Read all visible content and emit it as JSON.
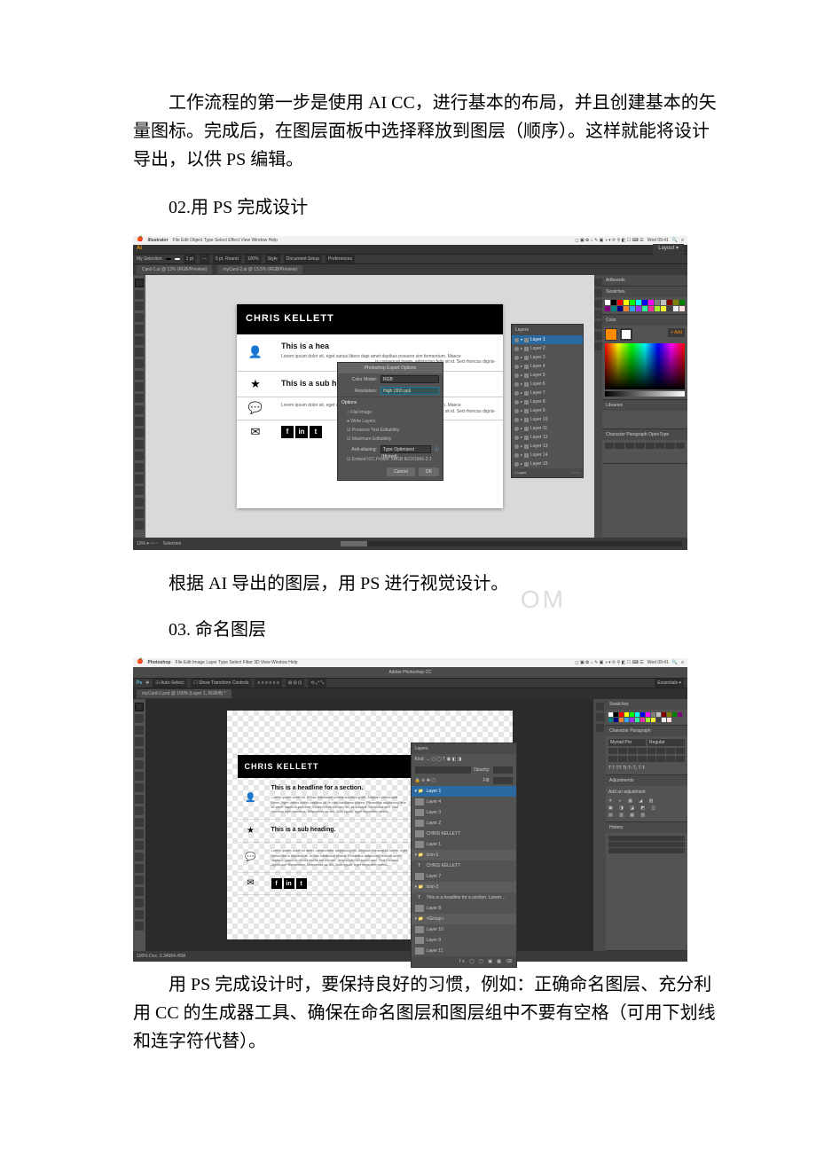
{
  "para1": "工作流程的第一步是使用 AI CC，进行基本的布局，并且创建基本的矢量图标。完成后，在图层面板中选择释放到图层（顺序）。这样就能将设计导出，以供 PS 编辑。",
  "h2": "02.用 PS 完成设计",
  "para2": "根据 AI 导出的图层，用 PS 进行视觉设计。",
  "h3": "03. 命名图层",
  "para3": "用 PS 完成设计时，要保持良好的习惯，例如：正确命名图层、充分利用 CC 的生成器工具、确保在命名图层和图层组中不要有空格（可用下划线和连字符代替）。",
  "watermark": "OM",
  "mac": {
    "ai_app": "Illustrator",
    "ps_app": "Photoshop",
    "menus_ai": "File  Edit  Object  Type  Select  Effect  View  Window  Help",
    "menus_ps": "File  Edit  Image  Layer  Type  Select  Filter  3D  View  Window  Help",
    "clock": "Wed 09:41",
    "status_icons": "◻ ▣ ✿ ⌂ ✎ ▣ ◑ ▾ ⟳ ⚲ ◧ ☐ ⌨ ☰"
  },
  "ai": {
    "brand": "Ai",
    "toolbar_right": "Layout ▾",
    "ctrlbar_left": "My Selection",
    "ctrlbar_doc": "Document Setup",
    "ctrlbar_pref": "Preferences",
    "tab1": "Card-1.ai @ 13% (RGB/Preview)",
    "tab2": "myCard-2.ai @ 13.5% (RGB/Preview)",
    "artboard_panel": "Artboards",
    "header": "CHRIS KELLETT",
    "row1_h": "This is a hea",
    "row1_p": "Lorem ipsum dolor sit, eget varius libero dapi amet dapibus posuere sim fermentum. Maece",
    "row1_p_tail": "is consequat lorem, adipiscing felis sit id. Sed rhoncus dignis-",
    "row2_h": "This is a sub he",
    "row2_p": "Lorem ipsum dolor sit, eget varius libero dapi amet dapibus posuere sim fermentum. Maece",
    "social": [
      "f",
      "in",
      "t"
    ],
    "dialog": {
      "title": "Photoshop Export Options",
      "color_model_lbl": "Color Model:",
      "color_model_val": "RGB",
      "resolution_lbl": "Resolution:",
      "resolution_val": "High (300 ppi)",
      "options": "Options",
      "opt1": "Flat Image",
      "opt2": "Write Layers",
      "opt3": "Preserve Text Editability",
      "opt4": "Maximum Editability",
      "aa_lbl": "Anti-aliasing:",
      "aa_val": "Type Optimized (Hinted)",
      "icc": "Embed ICC Profile: sRGB IEC61966-2.1",
      "cancel": "Cancel",
      "ok": "OK"
    },
    "layers": {
      "title": "Layers",
      "main": "Layer 1",
      "items": [
        "Layer 2",
        "Layer 3",
        "Layer 4",
        "Layer 5",
        "Layer 6",
        "Layer 7",
        "Layer 8",
        "Layer 9",
        "Layer 10",
        "Layer 11",
        "Layer 12",
        "Layer 13",
        "Layer 14",
        "Layer 15"
      ],
      "footer": "1 Layer"
    },
    "right": {
      "swatches": "Swatches",
      "color": "Color",
      "libraries": "Libraries",
      "character": "Character  Paragraph  OpenType"
    },
    "status_left": "13%",
    "status_sel": "Selection"
  },
  "ps": {
    "brand": "Ps",
    "window_title": "Adobe Photoshop CC",
    "ctrl_left": "Auto-Select:",
    "ctrl_menu": "Show Transform Controls",
    "doc_tab": "myCard-2.psd @ 100% (Layer 1, RGB/8) *",
    "header": "CHRIS KELLETT",
    "row1_h": "This is a headline for a section.",
    "row1_p": "Lorem ipsum dolor sit. In hac habitasse platea adipiscing elit. Aliquam consequat lorem, eget varius libero dapibus at. In hac habitasse platea. Phasellus adipiscing felis sit amet dapibus posuere. Morbi mollis rutrum nisl, ut suscipit nisl luctus sed. Sed rhoncus eget faucibus. Maecenas ac dui. Duis ligula, eget imperdiet metus.",
    "row2_h": "This is a sub heading.",
    "row2_p": "Lorem ipsum dolor sit amet, consectetur adipiscing elit. Aliquam consequat lorem, eget varius libero dapibus at. In hac habitasse platea. Phasellus adipiscing felis sit amet dapibus posuere. Morbi mollis rutrum nisl, ut suscipit nisl luctus sed. Sed rhoncus dignis-sim fermentum. Maecenas ac dui. Duis ligula, eget imperdiet metus.",
    "social": [
      "f",
      "in",
      "t"
    ],
    "layers": {
      "title": "Layers",
      "kind": "Kind",
      "opacity_lbl": "Opacity:",
      "fill_lbl": "Fill:",
      "group1": "Layer 1",
      "items1": [
        "Layer 4",
        "Layer 3",
        "Layer 2",
        "CHRIS KELLETT",
        "Layer 1"
      ],
      "group2": "icon-1",
      "t1": "This is a headline for a section. Lorem ipsum dolor sit amet co...",
      "group3": "icon-2",
      "t2": "Layer 7",
      "t3": "Layer 8",
      "group4": "<Group>",
      "items4": [
        "Layer 10",
        "Layer 9",
        "Layer 11"
      ],
      "footer_icons": "fx ◯ ▢ ▣ ▦ ⌫"
    },
    "right": {
      "swatches": "Swatches",
      "char": "Character  Paragraph",
      "font": "Myriad Pro",
      "style": "Regular",
      "adjust": "Adjustments",
      "addadj": "Add an adjustment",
      "history": "History"
    },
    "status": "100%    Doc: 2.34M/4.45M"
  },
  "swatch_colors": [
    "#ffffff",
    "#000000",
    "#ff0000",
    "#ffff00",
    "#00ff00",
    "#00ffff",
    "#0000ff",
    "#ff00ff",
    "#808080",
    "#c0c0c0",
    "#800000",
    "#808000",
    "#008000",
    "#800080",
    "#008080",
    "#000080",
    "#f08030",
    "#30a0f0",
    "#a030f0",
    "#30f0a0",
    "#f030a0",
    "#a0f030",
    "#f0f030",
    "#404040",
    "#eeeeee",
    "#ffdddd"
  ]
}
